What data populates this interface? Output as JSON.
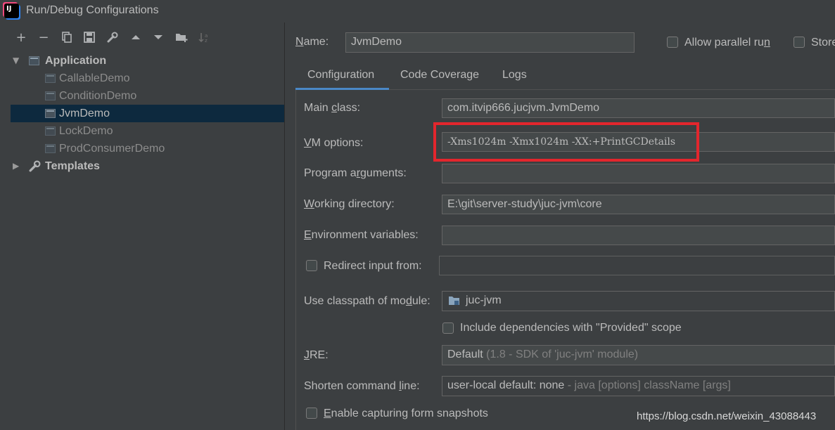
{
  "window": {
    "title": "Run/Debug Configurations",
    "logo_text": "IJ"
  },
  "toolbar": {
    "items": [
      "add-icon",
      "remove-icon",
      "copy-icon",
      "save-icon",
      "wrench-icon",
      "move-up-icon",
      "move-down-icon",
      "folder-add-icon",
      "sort-icon"
    ],
    "add": "+",
    "remove": "−"
  },
  "tree": {
    "application": "Application",
    "children": [
      "CallableDemo",
      "ConditionDemo",
      "JvmDemo",
      "LockDemo",
      "ProdConsumerDemo"
    ],
    "templates": "Templates",
    "selected": "JvmDemo"
  },
  "form": {
    "name_label_prefix": "N",
    "name_label_rest": "ame:",
    "name_value": "JvmDemo",
    "allow_parallel_label": "Allow parallel ru",
    "allow_parallel_u": "n",
    "store_label": "Store",
    "tabs": [
      "Configuration",
      "Code Coverage",
      "Logs"
    ],
    "main_class_label_a": "Main ",
    "main_class_label_u": "c",
    "main_class_label_b": "lass:",
    "main_class_value": "com.itvip666.jucjvm.JvmDemo",
    "vm_label_u": "V",
    "vm_label_rest": "M options:",
    "vm_value": "-Xms1024m -Xmx1024m -XX:+PrintGCDetails",
    "prog_args_label_a": "Program a",
    "prog_args_label_u": "r",
    "prog_args_label_b": "guments:",
    "workdir_label_u": "W",
    "workdir_label_rest": "orking directory:",
    "workdir_value": "E:\\git\\server-study\\juc-jvm\\core",
    "env_label_u": "E",
    "env_label_rest": "nvironment variables:",
    "redirect_label": "Redirect input from:",
    "classpath_label_a": "Use classpath of mo",
    "classpath_label_u": "d",
    "classpath_label_b": "ule:",
    "classpath_value": "juc-jvm",
    "include_deps_label": "Include dependencies with \"Provided\" scope",
    "jre_label_u": "J",
    "jre_label_rest": "RE:",
    "jre_value": "Default",
    "jre_hint": "(1.8 - SDK of 'juc-jvm' module)",
    "shorten_label_a": "Shorten command ",
    "shorten_label_u": "l",
    "shorten_label_b": "ine:",
    "shorten_value": "user-local default: none",
    "shorten_hint": "- java [options] className [args]",
    "capture_label_u": "E",
    "capture_label_rest": "nable capturing form snapshots"
  },
  "watermark": "https://blog.csdn.net/weixin_43088443",
  "colors": {
    "highlight_box": "#e3262d",
    "tab_underline": "#4a88c7",
    "selection": "#0d293e"
  }
}
